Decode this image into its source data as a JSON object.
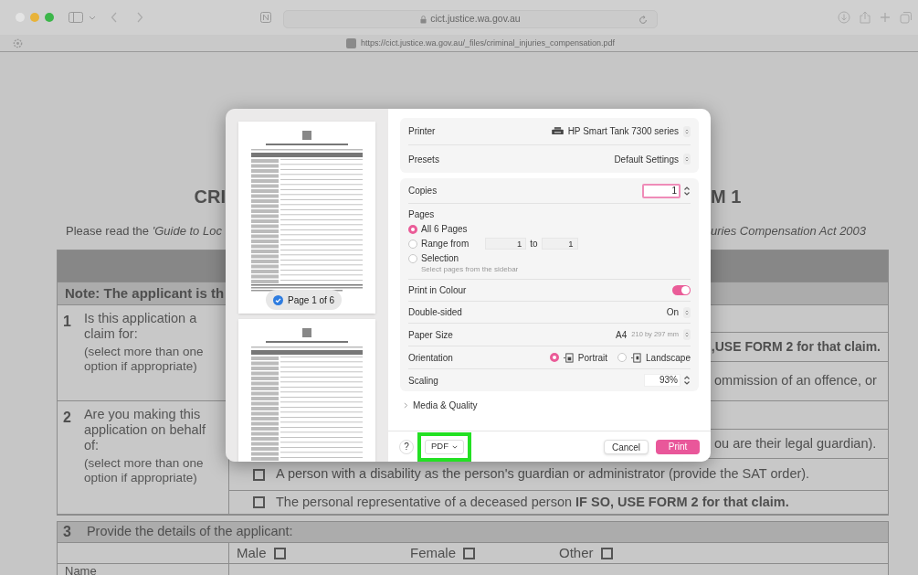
{
  "browser": {
    "address": "cict.justice.wa.gov.au",
    "page_url": "https://cict.justice.wa.gov.au/_files/criminal_injuries_compensation.pdf"
  },
  "document": {
    "title_left": "CRI",
    "title_right": "M 1",
    "intro_left": "Please read the *'Guide to Loc*",
    "intro_right": "uries Compensation Act 2003",
    "note": "Note: The applicant is th",
    "questions": [
      {
        "number": "1",
        "title": "Is this application a claim for:",
        "hint": "(select more than one option if appropriate)",
        "lines": [
          {
            "kind": "blank"
          },
          {
            "kind": "right",
            "text": ",USE FORM 2 for that claim."
          },
          {
            "kind": "left",
            "text": "ommission of an offence, or"
          }
        ]
      },
      {
        "number": "2",
        "title": "Are you making this application on behalf of:",
        "hint": "(select more than one option if appropriate)",
        "lines": [
          {
            "kind": "blank"
          },
          {
            "kind": "left",
            "text": "ou are their legal guardian)."
          },
          {
            "kind": "checkbox",
            "checked": false,
            "text": "A person with a disability as the person's guardian or administrator (provide the SAT order)."
          },
          {
            "kind": "checkbox",
            "checked": false,
            "text": "The personal representative of a deceased person  **IF SO, USE FORM 2 for that claim.**"
          }
        ]
      }
    ],
    "section_3": {
      "number": "3",
      "title": "Provide the details of the applicant:",
      "genders": [
        {
          "label": "Male",
          "checked": false
        },
        {
          "label": "Female",
          "checked": false
        },
        {
          "label": "Other",
          "checked": false
        }
      ],
      "field_label": "Name"
    }
  },
  "print_dialog": {
    "preview_pages": [
      {
        "label": "Page 1 of 6",
        "selected": true
      },
      {
        "selected": false
      }
    ],
    "printer": {
      "label": "Printer",
      "value": "HP Smart Tank 7300 series"
    },
    "presets": {
      "label": "Presets",
      "value": "Default Settings"
    },
    "copies": {
      "label": "Copies",
      "value": "1"
    },
    "pages": {
      "label": "Pages",
      "options": [
        {
          "kind": "plain",
          "label": "All 6 Pages",
          "selected": true
        },
        {
          "kind": "range",
          "label": "Range from",
          "selected": false,
          "from": "1",
          "to_label": "to",
          "to": "1"
        },
        {
          "kind": "hint",
          "label": "Selection",
          "selected": false,
          "hint": "Select pages from the sidebar"
        }
      ]
    },
    "print_in_colour": {
      "label": "Print in Colour",
      "on": true
    },
    "double_sided": {
      "label": "Double-sided",
      "value": "On"
    },
    "paper_size": {
      "label": "Paper Size",
      "value": "A4",
      "detail": "210 by 297 mm"
    },
    "orientation": {
      "label": "Orientation",
      "options": [
        {
          "label": "Portrait",
          "selected": true
        },
        {
          "label": "Landscape",
          "selected": false
        }
      ]
    },
    "scaling": {
      "label": "Scaling",
      "value": "93%"
    },
    "media_quality": {
      "label": "Media & Quality",
      "expanded": false
    },
    "footer": {
      "help": "?",
      "pdf": "PDF",
      "pdf_highlighted": true,
      "cancel": "Cancel",
      "print": "Print"
    }
  }
}
